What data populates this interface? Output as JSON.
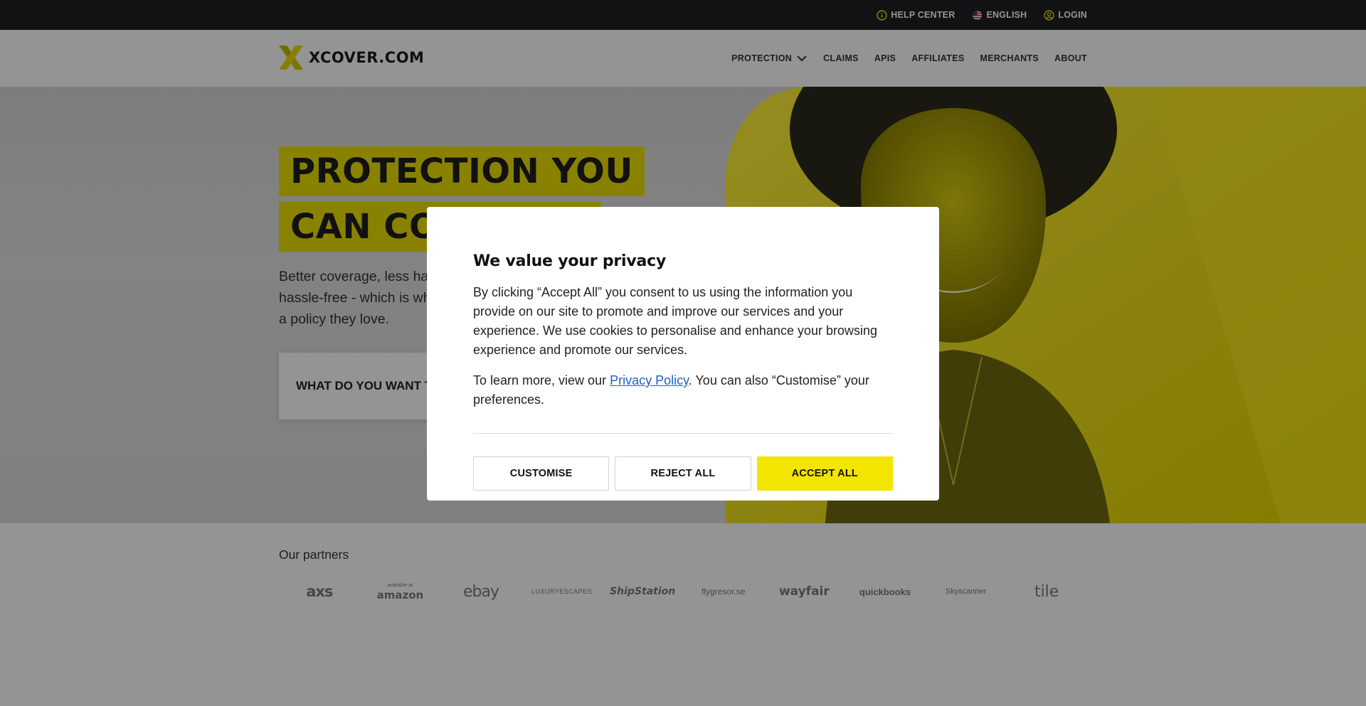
{
  "colors": {
    "brand_yellow": "#f2e500",
    "topbar_bg": "#1e1f22",
    "link_blue": "#1a63c9"
  },
  "topbar": {
    "help_center": "HELP CENTER",
    "language": "ENGLISH",
    "login": "LOGIN"
  },
  "header": {
    "logo_text": "XCOVER.COM",
    "nav": {
      "protection": "PROTECTION",
      "claims": "CLAIMS",
      "apis": "APIS",
      "affiliates": "AFFILIATES",
      "merchants": "MERCHANTS",
      "about": "ABOUT"
    }
  },
  "hero": {
    "headline_line1": "PROTECTION YOU",
    "headline_line2": "CAN COUNT ON",
    "subtitle": "Better coverage, less hassle - getting protected should be hassle-free - which is why over 3 million customers have chosen a policy they love.",
    "cta_label": "WHAT DO YOU WANT TO PROTECT?"
  },
  "partners": {
    "title": "Our partners",
    "logos": [
      "axs",
      "amazon",
      "ebay",
      "LUXURYESCAPES",
      "ShipStation",
      "flygresor.se",
      "wayfair",
      "quickbooks",
      "Skyscanner",
      "tile"
    ],
    "amazon_caption": "available at"
  },
  "cookie_modal": {
    "title": "We value your privacy",
    "body": "By clicking “Accept All” you consent to us using the information you provide on our site to promote and improve our services and your experience. We use cookies to personalise and enhance your browsing experience and promote our services.",
    "more_prefix": "To learn more, view our ",
    "privacy_link": "Privacy Policy",
    "more_suffix": ". You can also “Customise” your preferences.",
    "buttons": {
      "customise": "CUSTOMISE",
      "reject_all": "REJECT ALL",
      "accept_all": "ACCEPT ALL"
    }
  }
}
